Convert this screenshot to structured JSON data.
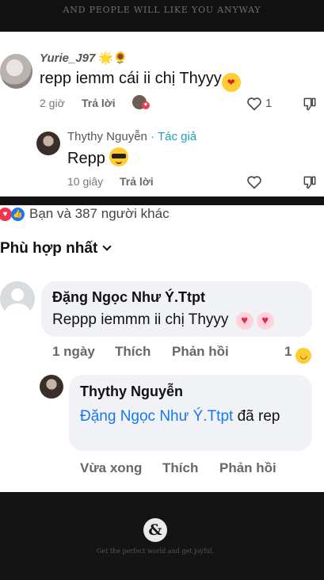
{
  "banner": {
    "tagline": "AND PEOPLE WILL LIKE YOU ANYWAY"
  },
  "thread1": {
    "comment": {
      "username": "Yurie_J97",
      "username_emoji": "🌟🌻",
      "text": "repp iemm cái ii chị Thyyy",
      "emoji": "😘",
      "time": "2 giờ",
      "reply_label": "Trả lời",
      "like_count": "1"
    },
    "reply": {
      "username": "Thythy Nguyễn",
      "separator": " · ",
      "author_badge": "Tác giả",
      "text": "Repp",
      "emoji": "😎",
      "time": "10 giây",
      "reply_label": "Trả lời"
    }
  },
  "thread2": {
    "reactions_summary": "Bạn và 387 người khác",
    "sort_label": "Phù hợp nhất",
    "comment": {
      "username": "Đặng Ngọc Như Ý.Ttpt",
      "text": "Reppp iemmm ii chị Thyyy",
      "emoji": "💗💗",
      "time": "1 ngày",
      "like_label": "Thích",
      "reply_label": "Phản hồi",
      "reaction_count": "1",
      "reaction_emoji": "😆"
    },
    "reply": {
      "username": "Thythy Nguyễn",
      "mention": "Đặng Ngọc Như Ý.Ttpt",
      "text_after_mention": " đã rep",
      "time": "Vừa xong",
      "like_label": "Thích",
      "reply_label": "Phản hồi"
    }
  },
  "footer": {
    "logo": "&",
    "slogan": "Get the perfect world and get joyful."
  },
  "colors": {
    "author_badge": "#1da1b8",
    "mention": "#1877f2",
    "bubble": "#f0f2f5",
    "heart": "#f0354f"
  }
}
